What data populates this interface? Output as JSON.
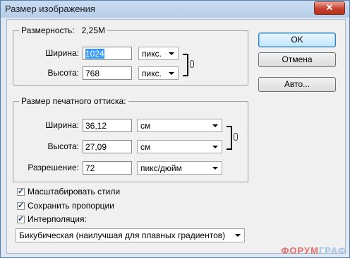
{
  "window": {
    "title": "Размер изображения",
    "close_glyph": "✕"
  },
  "pixel_dimensions": {
    "legend": "Размерность:",
    "size": "2,25M",
    "width_label": "Ширина:",
    "width_value": "1024",
    "width_unit": "пикс.",
    "height_label": "Высота:",
    "height_value": "768",
    "height_unit": "пикс."
  },
  "document_size": {
    "legend": "Размер печатного оттиска:",
    "width_label": "Ширина:",
    "width_value": "36,12",
    "width_unit": "см",
    "height_label": "Высота:",
    "height_value": "27,09",
    "height_unit": "см",
    "resolution_label": "Разрешение:",
    "resolution_value": "72",
    "resolution_unit": "пикс/дюйм"
  },
  "buttons": {
    "ok": "OK",
    "cancel": "Отмена",
    "auto": "Авто..."
  },
  "options": {
    "scale_styles": {
      "label": "Масштабировать стили",
      "checked": true
    },
    "constrain_proportions": {
      "label": "Сохранить пропорции",
      "checked": true
    },
    "resample": {
      "label": "Интерполяция:",
      "checked": true
    }
  },
  "resample_method": "Бикубическая (наилучшая для плавных градиентов)",
  "check_glyph": "✓",
  "watermark": {
    "part1": "ФОРУМ",
    "part2": "ГРАФ"
  },
  "colors": {
    "selection": "#3399ff",
    "close_button": "#c7412d",
    "ok_border": "#3c7fb1"
  }
}
